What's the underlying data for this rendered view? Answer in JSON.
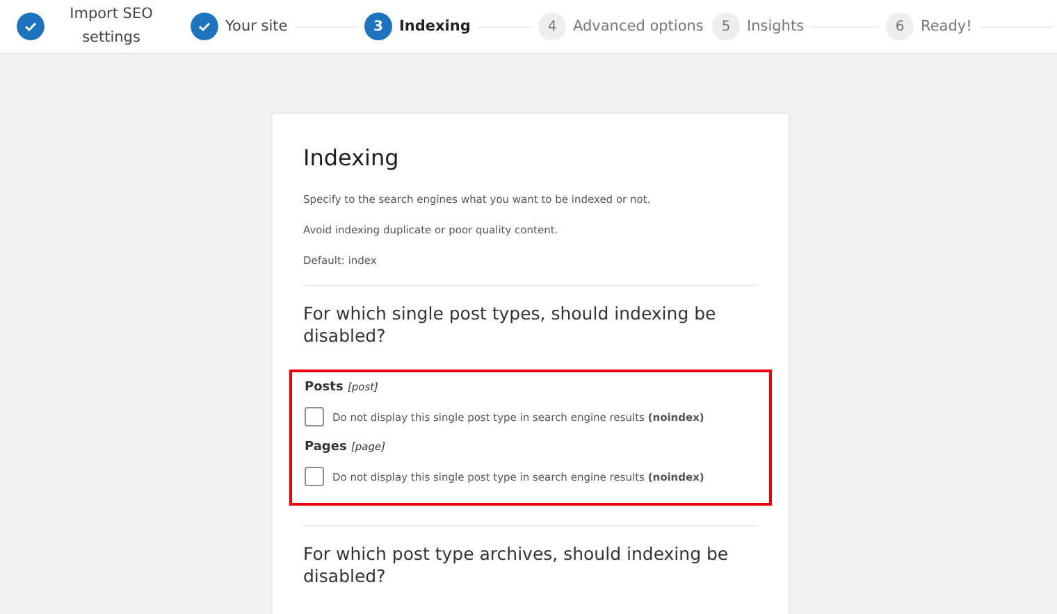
{
  "steps": [
    {
      "label": "Import SEO settings",
      "completed": true,
      "selected": false
    },
    {
      "label": "Your site",
      "completed": true,
      "selected": false
    },
    {
      "number": "3",
      "label": "Indexing",
      "completed": false,
      "selected": true
    },
    {
      "number": "4",
      "label": "Advanced options",
      "completed": false,
      "selected": false
    },
    {
      "number": "5",
      "label": "Insights",
      "completed": false,
      "selected": false
    },
    {
      "number": "6",
      "label": "Ready!",
      "completed": false,
      "selected": false
    }
  ],
  "card": {
    "title": "Indexing",
    "descriptions": [
      "Specify to the search engines what you want to be indexed or not.",
      "Avoid indexing duplicate or poor quality content.",
      "Default: index"
    ],
    "sections": [
      {
        "question": "For which single post types, should indexing be disabled?",
        "highlighted": true,
        "items": [
          {
            "name": "Posts",
            "slug": "[post]",
            "option": "Do not display this single post type in search engine results **(noindex)**",
            "checked": false
          },
          {
            "name": "Pages",
            "slug": "[page]",
            "option": "Do not display this single post type in search engine results **(noindex)**",
            "checked": false
          }
        ]
      },
      {
        "question": "For which post type archives, should indexing be disabled?"
      }
    ]
  }
}
